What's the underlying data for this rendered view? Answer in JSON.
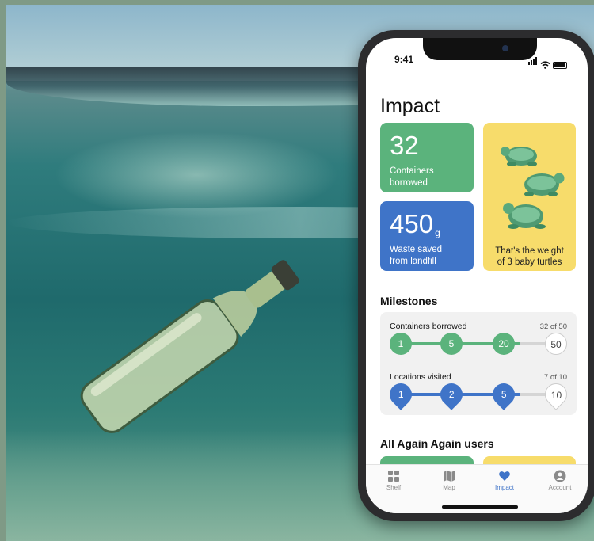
{
  "phone": {
    "status_time": "9:41"
  },
  "impact": {
    "title": "Impact",
    "containers": {
      "value": "32",
      "label_line1": "Containers",
      "label_line2": "borrowed"
    },
    "waste": {
      "value": "450",
      "unit": "g",
      "label_line1": "Waste saved",
      "label_line2": "from landfill"
    },
    "turtles": {
      "line1": "That's the weight",
      "line2": "of 3 baby turtles"
    }
  },
  "milestones": {
    "title": "Milestones",
    "containers": {
      "label": "Containers borrowed",
      "count": "32 of 50",
      "steps": [
        "1",
        "5",
        "20",
        "50"
      ]
    },
    "locations": {
      "label": "Locations visited",
      "count": "7 of 10",
      "steps": [
        "1",
        "2",
        "5",
        "10"
      ]
    }
  },
  "community": {
    "title": "All Again Again users"
  },
  "tabs": [
    {
      "label": "Shelf",
      "icon": "grid-icon"
    },
    {
      "label": "Map",
      "icon": "map-icon"
    },
    {
      "label": "Impact",
      "icon": "heart-icon",
      "active": true
    },
    {
      "label": "Account",
      "icon": "account-icon"
    }
  ],
  "colors": {
    "green": "#5bb37c",
    "blue": "#3f74c8",
    "yellow": "#f7dc6b"
  }
}
